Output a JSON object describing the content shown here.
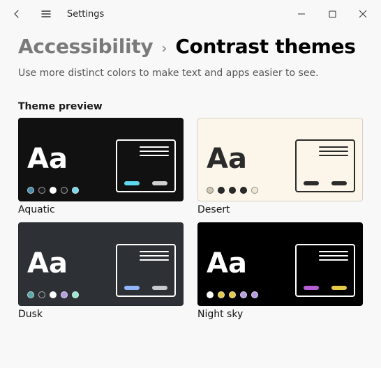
{
  "app_title": "Settings",
  "breadcrumb": {
    "parent": "Accessibility",
    "separator": "›",
    "current": "Contrast themes"
  },
  "subtitle": "Use more distinct colors to make text and apps easier to see.",
  "section": {
    "label": "Theme preview"
  },
  "themes": {
    "aquatic": {
      "name": "Aquatic",
      "bg": "#111111",
      "fg": "#ffffff",
      "swatches": [
        "#4a8aaa",
        "#1a1a1a",
        "#ffffff",
        "#1a1a1a",
        "#79d6ea"
      ],
      "panel_border": "#ffffff",
      "line_color": "#ffffff",
      "pill_left": "#5fd7ee",
      "pill_right": "#cfd0d1"
    },
    "desert": {
      "name": "Desert",
      "bg": "#fbf6e9",
      "fg": "#2b2b2b",
      "swatches": [
        "#cfc9b5",
        "#2b2b2b",
        "#2b2b2b",
        "#2b2b2b",
        "#efe9d5"
      ],
      "panel_border": "#2b2b2b",
      "line_color": "#2b2b2b",
      "pill_left": "#2b2b2b",
      "pill_right": "#2b2b2b"
    },
    "dusk": {
      "name": "Dusk",
      "bg": "#2d3136",
      "fg": "#ffffff",
      "swatches": [
        "#5aa7a7",
        "#2d3136",
        "#ffffff",
        "#b79de0",
        "#9be7d1"
      ],
      "panel_border": "#ffffff",
      "line_color": "#ffffff",
      "pill_left": "#8fb7ff",
      "pill_right": "#c7cacd"
    },
    "nightsky": {
      "name": "Night sky",
      "bg": "#000000",
      "fg": "#ffffff",
      "swatches": [
        "#ffffff",
        "#e7c94a",
        "#e7c94a",
        "#b79de0",
        "#b79de0"
      ],
      "panel_border": "#ffffff",
      "line_color": "#ffffff",
      "pill_left": "#b75ed6",
      "pill_right": "#e7c94a"
    }
  }
}
